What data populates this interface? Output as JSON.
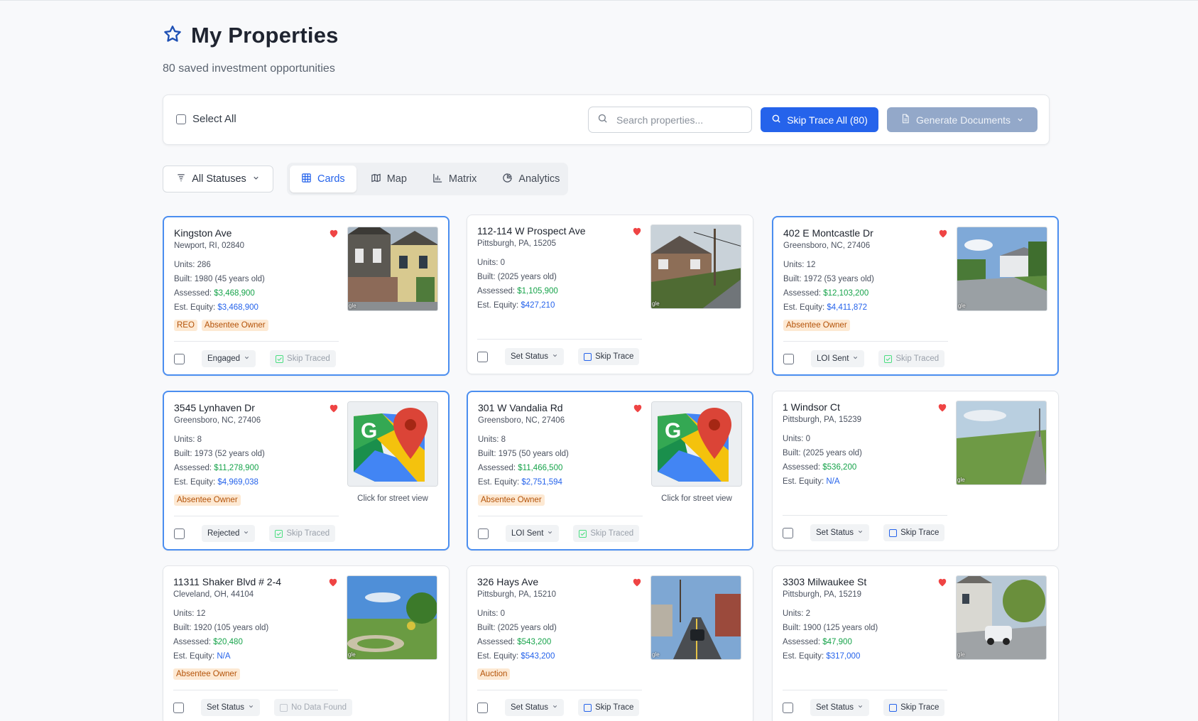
{
  "header": {
    "title": "My Properties",
    "subtitle": "80 saved investment opportunities"
  },
  "toolbar": {
    "select_all_label": "Select All",
    "search_placeholder": "Search properties...",
    "skip_trace_all_label": "Skip Trace All (80)",
    "generate_documents_label": "Generate Documents"
  },
  "filters": {
    "status_filter_label": "All Statuses",
    "views": [
      "Cards",
      "Map",
      "Matrix",
      "Analytics"
    ],
    "active_view": "Cards"
  },
  "colors": {
    "primary": "#2563eb",
    "selected_border": "#4b8ef0",
    "assessed_green": "#16a34a",
    "heart_red": "#ef4444",
    "tag_bg": "#fde9d3",
    "tag_text": "#b45309"
  },
  "labels": {
    "units": "Units:",
    "built": "Built:",
    "assessed": "Assessed:",
    "equity": "Est. Equity:",
    "street_view": "Click for street view"
  },
  "cards": [
    {
      "address": "Kingston Ave",
      "city": "Newport, RI, 02840",
      "units": "286",
      "built": "1980 (45 years old)",
      "assessed": "$3,468,900",
      "equity": "$3,468,900",
      "tags": [
        "REO",
        "Absentee Owner"
      ],
      "status": "Engaged",
      "skip": "Skip Traced",
      "skip_state": "done",
      "selected": true,
      "image": "photo-house"
    },
    {
      "address": "112-114 W Prospect Ave",
      "city": "Pittsburgh, PA, 15205",
      "units": "0",
      "built": "(2025 years old)",
      "assessed": "$1,105,900",
      "equity": "$427,210",
      "tags": [],
      "status": "Set Status",
      "skip": "Skip Trace",
      "skip_state": "todo",
      "selected": false,
      "image": "photo-street"
    },
    {
      "address": "402 E Montcastle Dr",
      "city": "Greensboro, NC, 27406",
      "units": "12",
      "built": "1972 (53 years old)",
      "assessed": "$12,103,200",
      "equity": "$4,411,872",
      "tags": [
        "Absentee Owner"
      ],
      "status": "LOI Sent",
      "skip": "Skip Traced",
      "skip_state": "done",
      "selected": true,
      "image": "photo-complex"
    },
    {
      "address": "3545 Lynhaven Dr",
      "city": "Greensboro, NC, 27406",
      "units": "8",
      "built": "1973 (52 years old)",
      "assessed": "$11,278,900",
      "equity": "$4,969,038",
      "tags": [
        "Absentee Owner"
      ],
      "status": "Rejected",
      "skip": "Skip Traced",
      "skip_state": "done",
      "selected": true,
      "image": "google-maps"
    },
    {
      "address": "301 W Vandalia Rd",
      "city": "Greensboro, NC, 27406",
      "units": "8",
      "built": "1975 (50 years old)",
      "assessed": "$11,466,500",
      "equity": "$2,751,594",
      "tags": [
        "Absentee Owner"
      ],
      "status": "LOI Sent",
      "skip": "Skip Traced",
      "skip_state": "done",
      "selected": true,
      "image": "google-maps"
    },
    {
      "address": "1 Windsor Ct",
      "city": "Pittsburgh, PA, 15239",
      "units": "0",
      "built": "(2025 years old)",
      "assessed": "$536,200",
      "equity": "N/A",
      "tags": [],
      "status": "Set Status",
      "skip": "Skip Trace",
      "skip_state": "todo",
      "selected": false,
      "image": "photo-field"
    },
    {
      "address": "11311 Shaker Blvd # 2-4",
      "city": "Cleveland, OH, 44104",
      "units": "12",
      "built": "1920 (105 years old)",
      "assessed": "$20,480",
      "equity": "N/A",
      "tags": [
        "Absentee Owner"
      ],
      "status": "Set Status",
      "skip": "No Data Found",
      "skip_state": "none",
      "selected": false,
      "image": "photo-park"
    },
    {
      "address": "326 Hays Ave",
      "city": "Pittsburgh, PA, 15210",
      "units": "0",
      "built": "(2025 years old)",
      "assessed": "$543,200",
      "equity": "$543,200",
      "tags": [
        "Auction"
      ],
      "status": "Set Status",
      "skip": "Skip Trace",
      "skip_state": "todo",
      "selected": false,
      "image": "photo-road"
    },
    {
      "address": "3303 Milwaukee St",
      "city": "Pittsburgh, PA, 15219",
      "units": "2",
      "built": "1900 (125 years old)",
      "assessed": "$47,900",
      "equity": "$317,000",
      "tags": [],
      "status": "Set Status",
      "skip": "Skip Trace",
      "skip_state": "todo",
      "selected": false,
      "image": "photo-hill"
    }
  ]
}
